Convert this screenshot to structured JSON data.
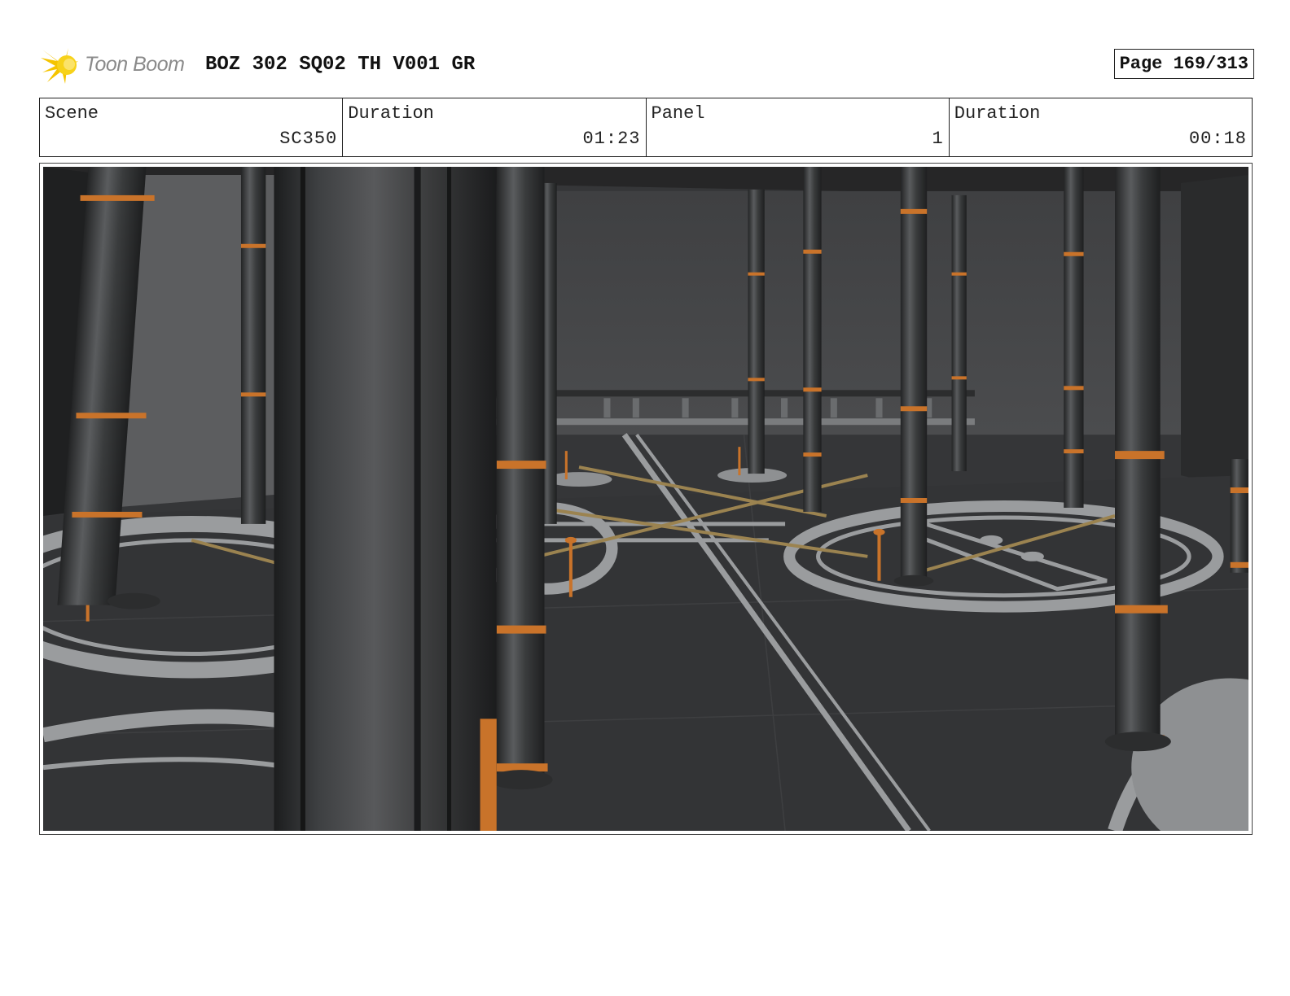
{
  "header": {
    "logo_text": "Toon Boom",
    "project_title": "BOZ 302 SQ02 TH V001 GR",
    "page_label": "Page 169/313"
  },
  "info": {
    "scene_label": "Scene",
    "scene_value": "SC350",
    "scene_duration_label": "Duration",
    "scene_duration_value": "01:23",
    "panel_label": "Panel",
    "panel_value": "1",
    "panel_duration_label": "Duration",
    "panel_duration_value": "00:18"
  },
  "colors": {
    "logo_star": "#f5c400",
    "logo_text": "#8a8a8a",
    "floor": "#353638",
    "wall": "#4a4b4d",
    "ceiling": "#262627",
    "column": "#3c3e3f",
    "orange_band": "#d9782a",
    "floor_lines": "#9a9c9e",
    "gold_lines": "#9b8350"
  },
  "icons": {
    "logo": "toon-boom-star-icon"
  }
}
